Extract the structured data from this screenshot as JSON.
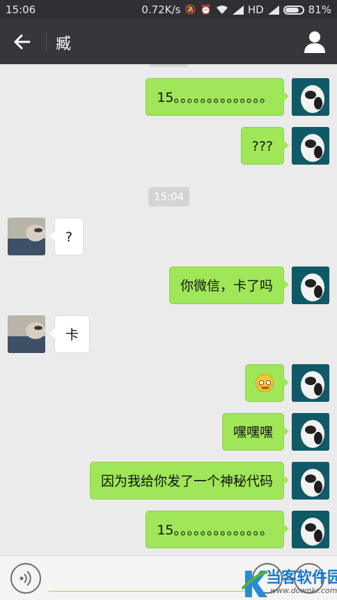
{
  "status_bar": {
    "time": "15:06",
    "net_speed": "0.72K/s",
    "network": "HD",
    "battery": "81%",
    "battery_level": 0.81
  },
  "header": {
    "title": "臧"
  },
  "chat": {
    "messages": [
      {
        "side": "me",
        "text": "15。。。。。。。。。。。。。。"
      },
      {
        "side": "me",
        "text": "???"
      },
      {
        "type": "timestamp",
        "text": "15:04"
      },
      {
        "side": "them",
        "text": "?"
      },
      {
        "side": "me",
        "text": "你微信，卡了吗"
      },
      {
        "side": "them",
        "text": "卡"
      },
      {
        "side": "me",
        "icon": "blushing-smile-emoji"
      },
      {
        "side": "me",
        "text": "嘿嘿嘿"
      },
      {
        "side": "me",
        "text": "因为我给你发了一个神秘代码"
      },
      {
        "side": "me",
        "text": "15。。。。。。。。。。。。。。"
      }
    ]
  },
  "watermark": {
    "name": "当客软件园",
    "url": "www.downkr.com"
  },
  "colors": {
    "my_bubble": "#9fe658",
    "their_bubble": "#ffffff",
    "header_bg": "#35373b",
    "chat_bg": "#ebebeb"
  }
}
